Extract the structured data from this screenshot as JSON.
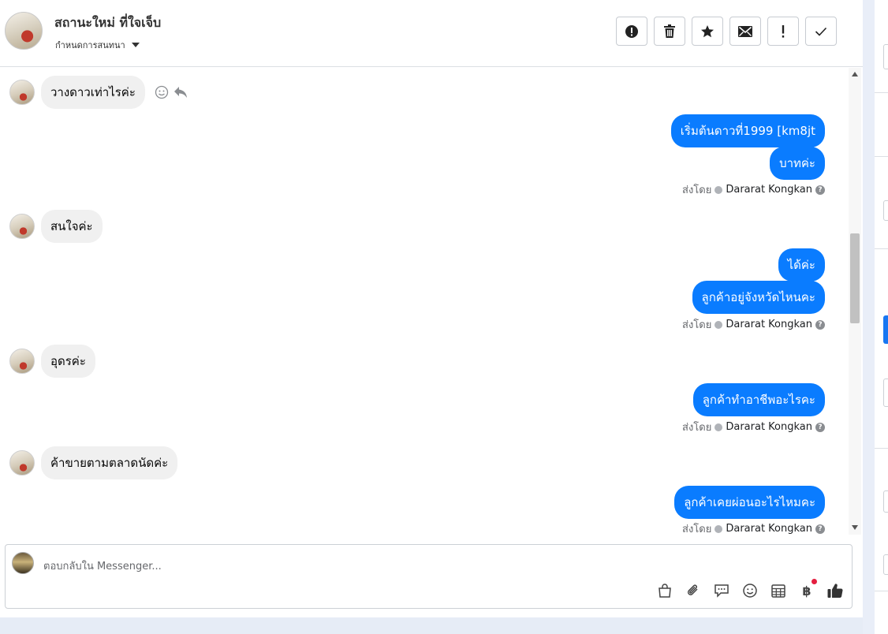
{
  "header": {
    "title": "สถานะใหม่ ที่ใจเจ็บ",
    "subtitle": "กำหนดการสนทนา"
  },
  "toolbar": {
    "buttons": [
      {
        "name": "spam-button",
        "icon": "alert-circle-icon"
      },
      {
        "name": "delete-button",
        "icon": "trash-icon"
      },
      {
        "name": "star-button",
        "icon": "star-icon"
      },
      {
        "name": "mark-unread-button",
        "icon": "envelope-icon"
      },
      {
        "name": "follow-up-button",
        "icon": "exclamation-icon"
      },
      {
        "name": "done-button",
        "icon": "check-icon"
      }
    ]
  },
  "messages": {
    "m1": "วางดาวเท่าไรค่ะ",
    "m2": "เริ่มต้นดาวที่1999 [km8jt",
    "m3": "บาทค่ะ",
    "m4": "สนใจค่ะ",
    "m5": "ได้ค่ะ",
    "m6": "ลูกค้าอยู่จังหวัดไหนคะ",
    "m7": "อุดรค่ะ",
    "m8": "ลูกค้าทำอาชีพอะไรคะ",
    "m9": "ค้าขายตามตลาดนัดค่ะ",
    "m10": "ลูกค้าเคยผ่อนอะไรไหมคะ"
  },
  "sent_by": {
    "label": "ส่งโดย",
    "name": "Dararat Kongkan"
  },
  "composer": {
    "placeholder": "ตอบกลับใน Messenger...",
    "currency_symbol": "฿"
  },
  "colors": {
    "outgoing_bubble": "#0a7cff",
    "incoming_bubble": "#f0f0f0",
    "badge": "#e41e3f"
  }
}
